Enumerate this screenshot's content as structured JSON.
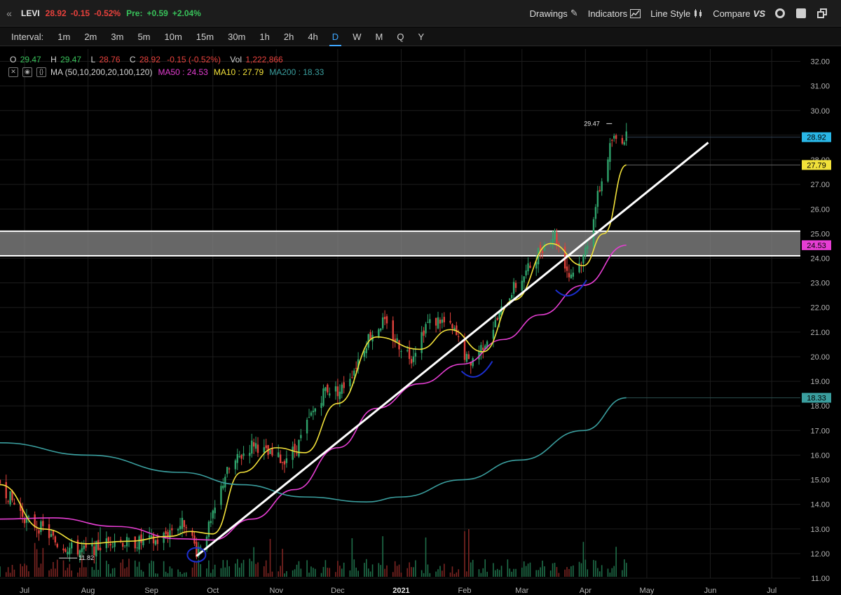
{
  "header": {
    "collapse_icon": "«",
    "symbol": "LEVI",
    "last": "28.92",
    "change": "-0.15",
    "change_pct": "-0.52%",
    "pre_label": "Pre:",
    "pre_change": "+0.59",
    "pre_change_pct": "+2.04%"
  },
  "toolbar": {
    "drawings": "Drawings",
    "indicators": "Indicators",
    "line_style": "Line Style",
    "compare": "Compare",
    "compare_icon": "VS"
  },
  "intervals": {
    "label": "Interval:",
    "items": [
      "1m",
      "2m",
      "3m",
      "5m",
      "10m",
      "15m",
      "30m",
      "1h",
      "2h",
      "4h",
      "D",
      "W",
      "M",
      "Q",
      "Y"
    ],
    "active": "D"
  },
  "ohlc": {
    "o_label": "O",
    "o": "29.47",
    "h_label": "H",
    "h": "29.47",
    "l_label": "L",
    "l": "28.76",
    "c_label": "C",
    "c": "28.92",
    "chg": "-0.15 (-0.52%)",
    "vol_label": "Vol",
    "vol": "1,222,866"
  },
  "ma_legend": {
    "name": "MA (50,10,200,20,100,120)",
    "ma50": "MA50 : 24.53",
    "ma10": "MA10 : 27.79",
    "ma200": "MA200 : 18.33"
  },
  "colors": {
    "up": "#2fa36b",
    "down": "#e0413b",
    "ma50": "#e63ed3",
    "ma10": "#f2e13a",
    "ma200": "#3a9e9e",
    "trendline": "#ffffff",
    "zone": "#8a8a8a",
    "circles": "#1c2fd0"
  },
  "chart_data": {
    "type": "candlestick",
    "title": "",
    "xlabel": "",
    "ylabel": "",
    "ylim": [
      11.0,
      32.5
    ],
    "yticks": [
      "11.00",
      "12.00",
      "13.00",
      "14.00",
      "15.00",
      "16.00",
      "17.00",
      "18.00",
      "19.00",
      "20.00",
      "21.00",
      "22.00",
      "23.00",
      "24.00",
      "25.00",
      "26.00",
      "27.00",
      "28.00",
      "29.00",
      "30.00",
      "31.00",
      "32.00"
    ],
    "x_range": [
      "2020-06-19",
      "2021-07-15"
    ],
    "x_ticks": [
      {
        "label": "Jul",
        "date": "2020-07-01"
      },
      {
        "label": "Aug",
        "date": "2020-08-01"
      },
      {
        "label": "Sep",
        "date": "2020-09-01"
      },
      {
        "label": "Oct",
        "date": "2020-10-01"
      },
      {
        "label": "Nov",
        "date": "2020-11-01"
      },
      {
        "label": "Dec",
        "date": "2020-12-01"
      },
      {
        "label": "2021",
        "date": "2021-01-01"
      },
      {
        "label": "Feb",
        "date": "2021-02-01"
      },
      {
        "label": "Mar",
        "date": "2021-03-01"
      },
      {
        "label": "Apr",
        "date": "2021-04-01"
      },
      {
        "label": "May",
        "date": "2021-05-01"
      },
      {
        "label": "Jun",
        "date": "2021-06-01"
      },
      {
        "label": "Jul",
        "date": "2021-07-01"
      }
    ],
    "price_path": [
      {
        "date": "2020-06-19",
        "close": 14.9
      },
      {
        "date": "2020-06-26",
        "close": 14.0
      },
      {
        "date": "2020-07-03",
        "close": 13.3
      },
      {
        "date": "2020-07-10",
        "close": 13.0
      },
      {
        "date": "2020-07-17",
        "close": 12.4
      },
      {
        "date": "2020-07-24",
        "close": 12.2
      },
      {
        "date": "2020-07-31",
        "close": 12.1
      },
      {
        "date": "2020-08-07",
        "close": 12.3
      },
      {
        "date": "2020-08-14",
        "close": 12.6
      },
      {
        "date": "2020-08-21",
        "close": 12.4
      },
      {
        "date": "2020-08-28",
        "close": 12.5
      },
      {
        "date": "2020-09-04",
        "close": 12.5
      },
      {
        "date": "2020-09-11",
        "close": 13.0
      },
      {
        "date": "2020-09-18",
        "close": 13.3
      },
      {
        "date": "2020-09-23",
        "close": 12.1
      },
      {
        "date": "2020-09-30",
        "close": 13.2
      },
      {
        "date": "2020-10-07",
        "close": 15.2
      },
      {
        "date": "2020-10-14",
        "close": 15.9
      },
      {
        "date": "2020-10-21",
        "close": 16.5
      },
      {
        "date": "2020-10-28",
        "close": 16.0
      },
      {
        "date": "2020-11-04",
        "close": 15.8
      },
      {
        "date": "2020-11-11",
        "close": 16.3
      },
      {
        "date": "2020-11-18",
        "close": 17.6
      },
      {
        "date": "2020-11-25",
        "close": 18.7
      },
      {
        "date": "2020-12-02",
        "close": 18.6
      },
      {
        "date": "2020-12-09",
        "close": 19.5
      },
      {
        "date": "2020-12-16",
        "close": 20.8
      },
      {
        "date": "2020-12-23",
        "close": 21.4
      },
      {
        "date": "2020-12-30",
        "close": 20.6
      },
      {
        "date": "2021-01-06",
        "close": 20.0
      },
      {
        "date": "2021-01-13",
        "close": 21.3
      },
      {
        "date": "2021-01-20",
        "close": 21.5
      },
      {
        "date": "2021-01-27",
        "close": 21.0
      },
      {
        "date": "2021-02-03",
        "close": 19.7
      },
      {
        "date": "2021-02-10",
        "close": 20.5
      },
      {
        "date": "2021-02-17",
        "close": 21.5
      },
      {
        "date": "2021-02-24",
        "close": 22.7
      },
      {
        "date": "2021-03-03",
        "close": 23.4
      },
      {
        "date": "2021-03-10",
        "close": 24.4
      },
      {
        "date": "2021-03-17",
        "close": 25.0
      },
      {
        "date": "2021-03-24",
        "close": 23.3
      },
      {
        "date": "2021-03-31",
        "close": 24.0
      },
      {
        "date": "2021-04-07",
        "close": 26.5
      },
      {
        "date": "2021-04-14",
        "close": 28.8
      },
      {
        "date": "2021-04-21",
        "close": 28.92
      }
    ],
    "series": [
      {
        "name": "MA50",
        "points": [
          {
            "date": "2020-06-19",
            "y": 13.4
          },
          {
            "date": "2020-07-15",
            "y": 13.45
          },
          {
            "date": "2020-08-15",
            "y": 13.1
          },
          {
            "date": "2020-09-15",
            "y": 12.6
          },
          {
            "date": "2020-10-01",
            "y": 12.55
          },
          {
            "date": "2020-10-20",
            "y": 13.4
          },
          {
            "date": "2020-11-10",
            "y": 14.6
          },
          {
            "date": "2020-12-01",
            "y": 16.3
          },
          {
            "date": "2020-12-20",
            "y": 17.9
          },
          {
            "date": "2021-01-10",
            "y": 18.9
          },
          {
            "date": "2021-01-31",
            "y": 19.7
          },
          {
            "date": "2021-02-20",
            "y": 20.7
          },
          {
            "date": "2021-03-10",
            "y": 21.7
          },
          {
            "date": "2021-03-31",
            "y": 22.9
          },
          {
            "date": "2021-04-21",
            "y": 24.53
          }
        ]
      },
      {
        "name": "MA10",
        "points": [
          {
            "date": "2020-06-19",
            "y": 14.8
          },
          {
            "date": "2020-07-10",
            "y": 13.0
          },
          {
            "date": "2020-07-31",
            "y": 12.4
          },
          {
            "date": "2020-08-20",
            "y": 12.5
          },
          {
            "date": "2020-09-10",
            "y": 12.7
          },
          {
            "date": "2020-09-20",
            "y": 12.9
          },
          {
            "date": "2020-10-01",
            "y": 12.8
          },
          {
            "date": "2020-10-15",
            "y": 15.3
          },
          {
            "date": "2020-11-01",
            "y": 16.3
          },
          {
            "date": "2020-11-15",
            "y": 16.1
          },
          {
            "date": "2020-12-01",
            "y": 18.1
          },
          {
            "date": "2020-12-20",
            "y": 20.8
          },
          {
            "date": "2021-01-10",
            "y": 20.3
          },
          {
            "date": "2021-01-25",
            "y": 21.1
          },
          {
            "date": "2021-02-10",
            "y": 20.2
          },
          {
            "date": "2021-02-25",
            "y": 22.3
          },
          {
            "date": "2021-03-15",
            "y": 24.6
          },
          {
            "date": "2021-03-31",
            "y": 23.7
          },
          {
            "date": "2021-04-10",
            "y": 25.0
          },
          {
            "date": "2021-04-21",
            "y": 27.79
          }
        ]
      },
      {
        "name": "MA200",
        "points": [
          {
            "date": "2020-06-19",
            "y": 16.5
          },
          {
            "date": "2020-08-01",
            "y": 16.0
          },
          {
            "date": "2020-09-15",
            "y": 15.3
          },
          {
            "date": "2020-10-15",
            "y": 14.8
          },
          {
            "date": "2020-11-15",
            "y": 14.3
          },
          {
            "date": "2020-12-15",
            "y": 14.1
          },
          {
            "date": "2021-01-01",
            "y": 14.3
          },
          {
            "date": "2021-01-31",
            "y": 15.0
          },
          {
            "date": "2021-02-28",
            "y": 15.8
          },
          {
            "date": "2021-03-31",
            "y": 17.0
          },
          {
            "date": "2021-04-21",
            "y": 18.33
          }
        ]
      }
    ],
    "trendline": [
      {
        "date": "2020-09-23",
        "y": 11.9
      },
      {
        "date": "2021-05-31",
        "y": 28.7
      }
    ],
    "zone": [
      24.1,
      25.1
    ],
    "hline_ma10": 27.79,
    "price_labels": [
      {
        "text": "28.92",
        "value": 28.92,
        "bg": "#29b6e6"
      },
      {
        "text": "27.79",
        "value": 27.79,
        "bg": "#f2e13a"
      },
      {
        "text": "24.53",
        "value": 24.53,
        "bg": "#e63ed3"
      },
      {
        "text": "18.33",
        "value": 18.33,
        "bg": "#3a9e9e"
      }
    ],
    "annotations": [
      {
        "text": "29.47",
        "date": "2021-04-14",
        "y": 29.47
      },
      {
        "text": "11.82",
        "date": "2020-07-24",
        "y": 11.82
      }
    ],
    "circles": [
      {
        "date": "2020-09-23",
        "y": 11.95
      },
      {
        "date": "2021-02-07",
        "y": 19.3
      },
      {
        "date": "2021-03-25",
        "y": 22.6
      }
    ],
    "grid": true,
    "legend": "top-left"
  }
}
